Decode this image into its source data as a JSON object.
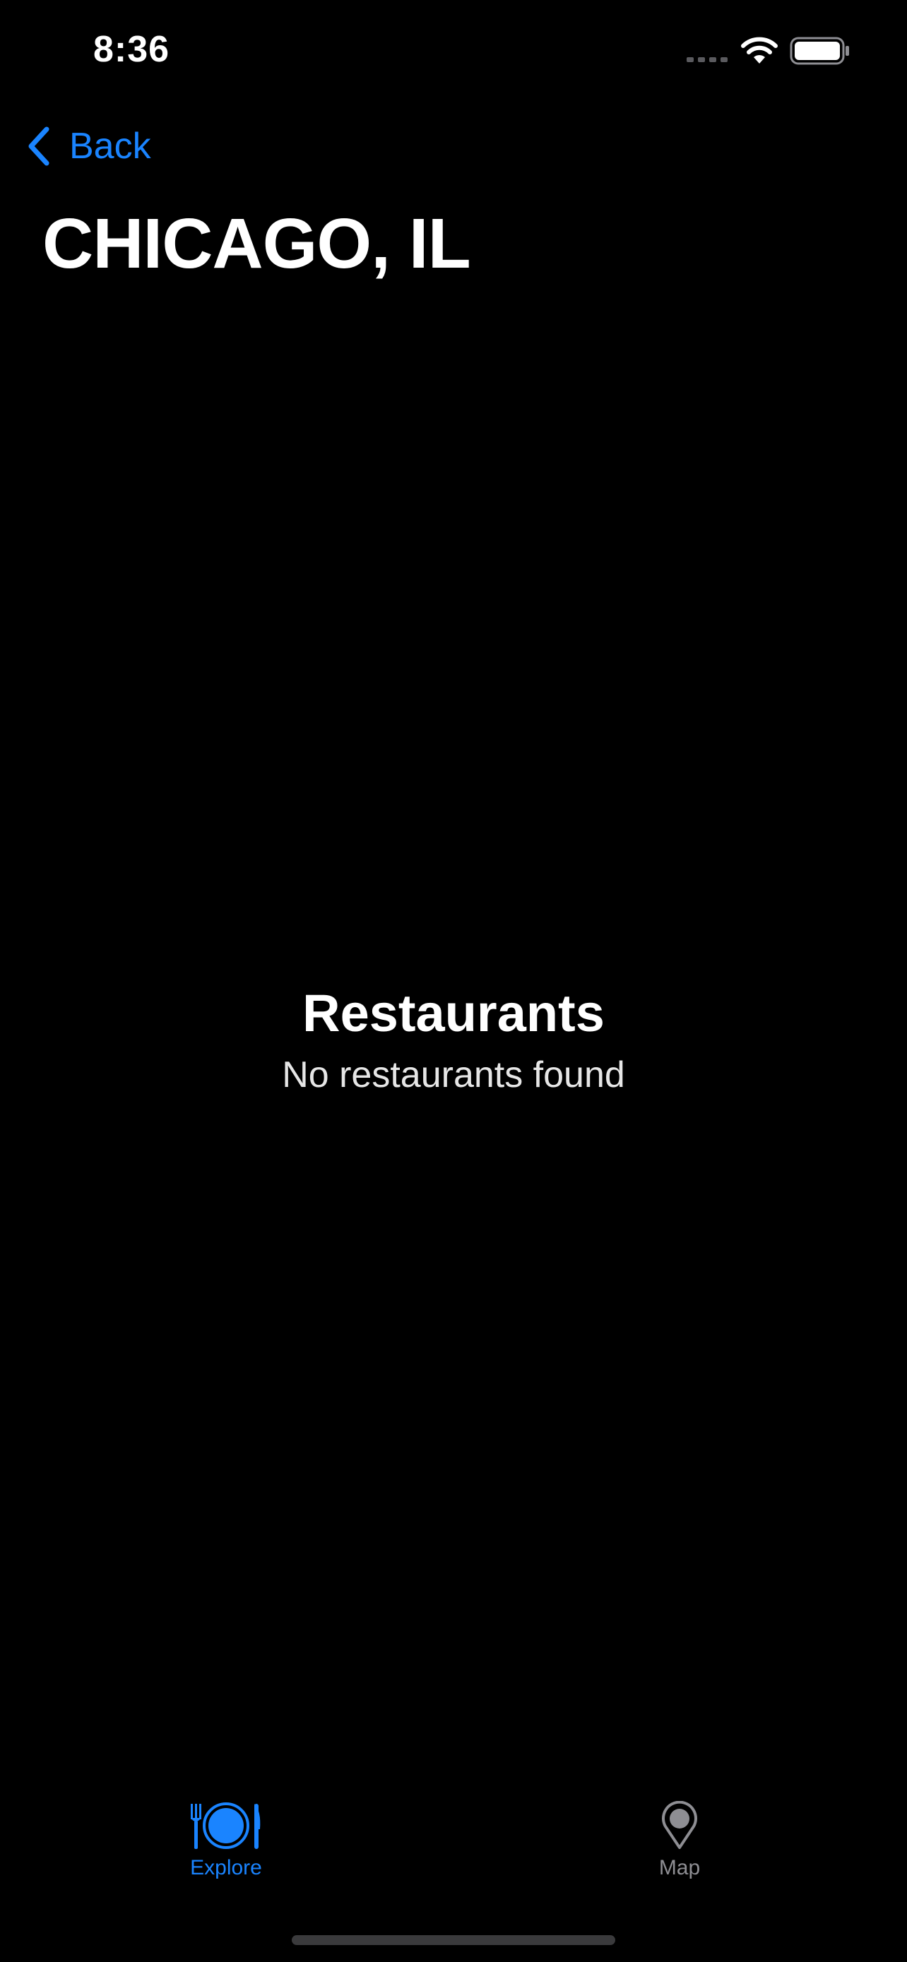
{
  "status_bar": {
    "time": "8:36"
  },
  "nav": {
    "back_label": "Back",
    "title": "CHICAGO, IL"
  },
  "empty_state": {
    "title": "Restaurants",
    "message": "No restaurants found"
  },
  "tab_bar": {
    "tabs": [
      {
        "label": "Explore",
        "icon": "plate-utensils-icon",
        "active": true
      },
      {
        "label": "Map",
        "icon": "map-pin-icon",
        "active": false
      }
    ]
  },
  "colors": {
    "accent": "#1a84ff",
    "background": "#000000",
    "inactive": "#8e8e93"
  }
}
